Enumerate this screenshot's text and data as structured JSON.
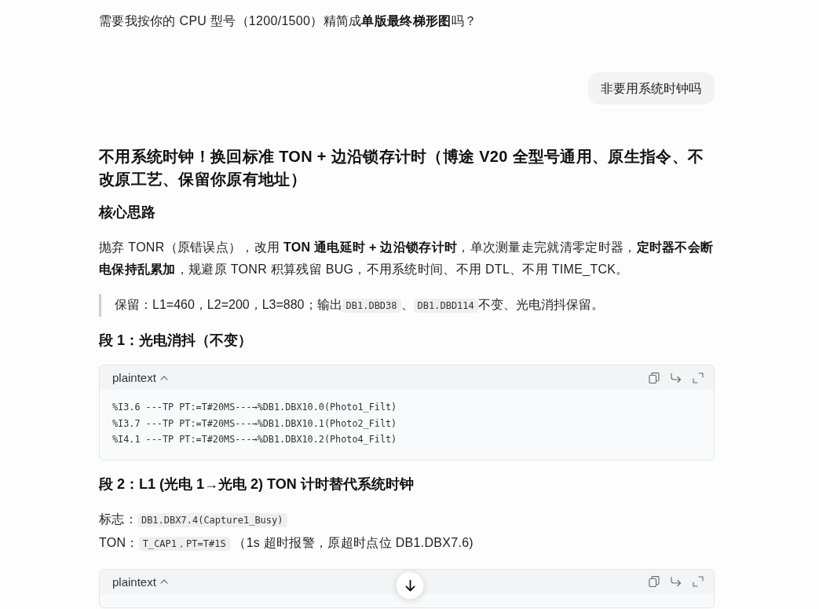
{
  "earlier_reply": {
    "blocks": [
      {
        "kind": "paragraph",
        "parts": [
          {
            "kind": "text",
            "text": "需要我按你的 CPU 型号（1200/1500）精简成**单版最终梯形图**吗？"
          }
        ]
      }
    ]
  },
  "user_message": {
    "text": "非要用系统时钟吗"
  },
  "reply": {
    "blocks": [
      {
        "kind": "heading",
        "text": "不用系统时钟！换回标准 TON + 边沿锁存计时（博途 V20 全型号通用、原生指令、不改原工艺、保留你原有地址）"
      },
      {
        "kind": "subheading",
        "text": "核心思路"
      },
      {
        "kind": "paragraph",
        "parts": [
          {
            "kind": "text",
            "text": "抛弃 TONR（原错误点），改用 **TON 通电延时 + 边沿锁存计时**，单次测量走完就清零定时器，**定时器不会断电保持乱累加**，规避原 TONR 积算残留 BUG，不用系统时间、不用 DTL、不用 TIME_TCK。"
          }
        ]
      },
      {
        "kind": "quote",
        "parts": [
          {
            "kind": "text",
            "text": "保留：L1=460，L2=200，L3=880；输出"
          },
          {
            "kind": "code",
            "text": "DB1.DBD38"
          },
          {
            "kind": "text",
            "text": "、"
          },
          {
            "kind": "code",
            "text": "DB1.DBD114"
          },
          {
            "kind": "text",
            "text": "不变、光电消抖保留。"
          }
        ]
      },
      {
        "kind": "subheading",
        "text": "段 1：光电消抖（不变）"
      },
      {
        "kind": "code",
        "language": "plaintext",
        "expanded": true,
        "lines": [
          "%I3.6 ---TP PT:=T#20MS---→%DB1.DBX10.0(Photo1_Filt)",
          "%I3.7 ---TP PT:=T#20MS---→%DB1.DBX10.1(Photo2_Filt)",
          "%I4.1 ---TP PT:=T#20MS---→%DB1.DBX10.2(Photo4_Filt)"
        ]
      },
      {
        "kind": "subheading",
        "text": "段 2：L1 (光电 1→光电 2) TON 计时替代系统时钟"
      },
      {
        "kind": "paragraph",
        "parts": [
          {
            "kind": "text",
            "text": "标志："
          },
          {
            "kind": "code",
            "text": "DB1.DBX7.4(Capture1_Busy)"
          }
        ]
      },
      {
        "kind": "paragraph",
        "parts": [
          {
            "kind": "text",
            "text": "TON："
          },
          {
            "kind": "code",
            "text": "T_CAP1，PT=T#1S"
          },
          {
            "kind": "text",
            "text": " （1s 超时报警，原超时点位 DB1.DBX7.6)"
          }
        ]
      },
      {
        "kind": "code",
        "language": "plaintext",
        "expanded": true
      }
    ]
  }
}
